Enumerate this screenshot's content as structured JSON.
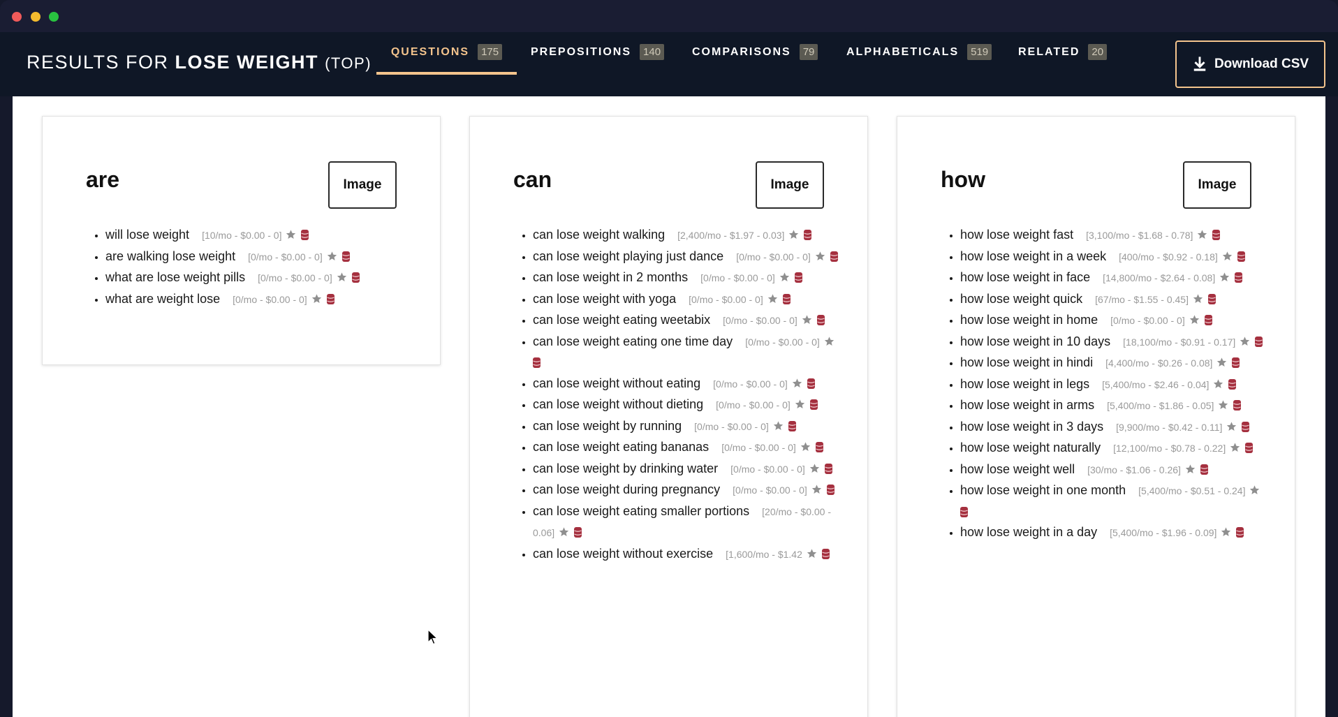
{
  "window": {
    "traffic_lights": [
      "close",
      "minimize",
      "zoom"
    ]
  },
  "header": {
    "results_prefix": "RESULTS FOR",
    "keyword": "LOSE WEIGHT",
    "suffix": "(TOP)",
    "tabs": [
      {
        "label": "QUESTIONS",
        "count": "175",
        "active": true
      },
      {
        "label": "PREPOSITIONS",
        "count": "140",
        "active": false
      },
      {
        "label": "COMPARISONS",
        "count": "79",
        "active": false
      },
      {
        "label": "ALPHABETICALS",
        "count": "519",
        "active": false
      },
      {
        "label": "RELATED",
        "count": "20",
        "active": false
      }
    ],
    "download_label": "Download CSV",
    "accent_color": "#f4c48d"
  },
  "cards": [
    {
      "title": "are",
      "image_label": "Image",
      "items": [
        {
          "text": "will lose weight",
          "meta": "[10/mo - $0.00 - 0]"
        },
        {
          "text": "are walking lose weight",
          "meta": "[0/mo - $0.00 - 0]"
        },
        {
          "text": "what are lose weight pills",
          "meta": "[0/mo - $0.00 - 0]"
        },
        {
          "text": "what are weight lose",
          "meta": "[0/mo - $0.00 - 0]"
        }
      ]
    },
    {
      "title": "can",
      "image_label": "Image",
      "items": [
        {
          "text": "can lose weight walking",
          "meta": "[2,400/mo - $1.97 - 0.03]"
        },
        {
          "text": "can lose weight playing just dance",
          "meta": "[0/mo - $0.00 - 0]"
        },
        {
          "text": "can lose weight in 2 months",
          "meta": "[0/mo - $0.00 - 0]"
        },
        {
          "text": "can lose weight with yoga",
          "meta": "[0/mo - $0.00 - 0]"
        },
        {
          "text": "can lose weight eating weetabix",
          "meta": "[0/mo - $0.00 - 0]"
        },
        {
          "text": "can lose weight eating one time day",
          "meta": "[0/mo - $0.00 - 0]"
        },
        {
          "text": "can lose weight without eating",
          "meta": "[0/mo - $0.00 - 0]"
        },
        {
          "text": "can lose weight without dieting",
          "meta": "[0/mo - $0.00 - 0]"
        },
        {
          "text": "can lose weight by running",
          "meta": "[0/mo - $0.00 - 0]"
        },
        {
          "text": "can lose weight eating bananas",
          "meta": "[0/mo - $0.00 - 0]"
        },
        {
          "text": "can lose weight by drinking water",
          "meta": "[0/mo - $0.00 - 0]"
        },
        {
          "text": "can lose weight during pregnancy",
          "meta": "[0/mo - $0.00 - 0]"
        },
        {
          "text": "can lose weight eating smaller portions",
          "meta": "[20/mo - $0.00 - 0.06]"
        },
        {
          "text": "can lose weight without exercise",
          "meta": "[1,600/mo - $1.42"
        }
      ]
    },
    {
      "title": "how",
      "image_label": "Image",
      "items": [
        {
          "text": "how lose weight fast",
          "meta": "[3,100/mo - $1.68 - 0.78]"
        },
        {
          "text": "how lose weight in a week",
          "meta": "[400/mo - $0.92 - 0.18]"
        },
        {
          "text": "how lose weight in face",
          "meta": "[14,800/mo - $2.64 - 0.08]"
        },
        {
          "text": "how lose weight quick",
          "meta": "[67/mo - $1.55 - 0.45]"
        },
        {
          "text": "how lose weight in home",
          "meta": "[0/mo - $0.00 - 0]"
        },
        {
          "text": "how lose weight in 10 days",
          "meta": "[18,100/mo - $0.91 - 0.17]"
        },
        {
          "text": "how lose weight in hindi",
          "meta": "[4,400/mo - $0.26 - 0.08]"
        },
        {
          "text": "how lose weight in legs",
          "meta": "[5,400/mo - $2.46 - 0.04]"
        },
        {
          "text": "how lose weight in arms",
          "meta": "[5,400/mo - $1.86 - 0.05]"
        },
        {
          "text": "how lose weight in 3 days",
          "meta": "[9,900/mo - $0.42 - 0.11]"
        },
        {
          "text": "how lose weight naturally",
          "meta": "[12,100/mo - $0.78 - 0.22]"
        },
        {
          "text": "how lose weight well",
          "meta": "[30/mo - $1.06 - 0.26]"
        },
        {
          "text": "how lose weight in one month",
          "meta": "[5,400/mo - $0.51 - 0.24]"
        },
        {
          "text": "how lose weight in a day",
          "meta": "[5,400/mo - $1.96 - 0.09]"
        }
      ]
    }
  ],
  "icons": {
    "star": "star-icon",
    "database": "database-icon",
    "download": "download-icon",
    "cursor": "mouse-pointer"
  }
}
